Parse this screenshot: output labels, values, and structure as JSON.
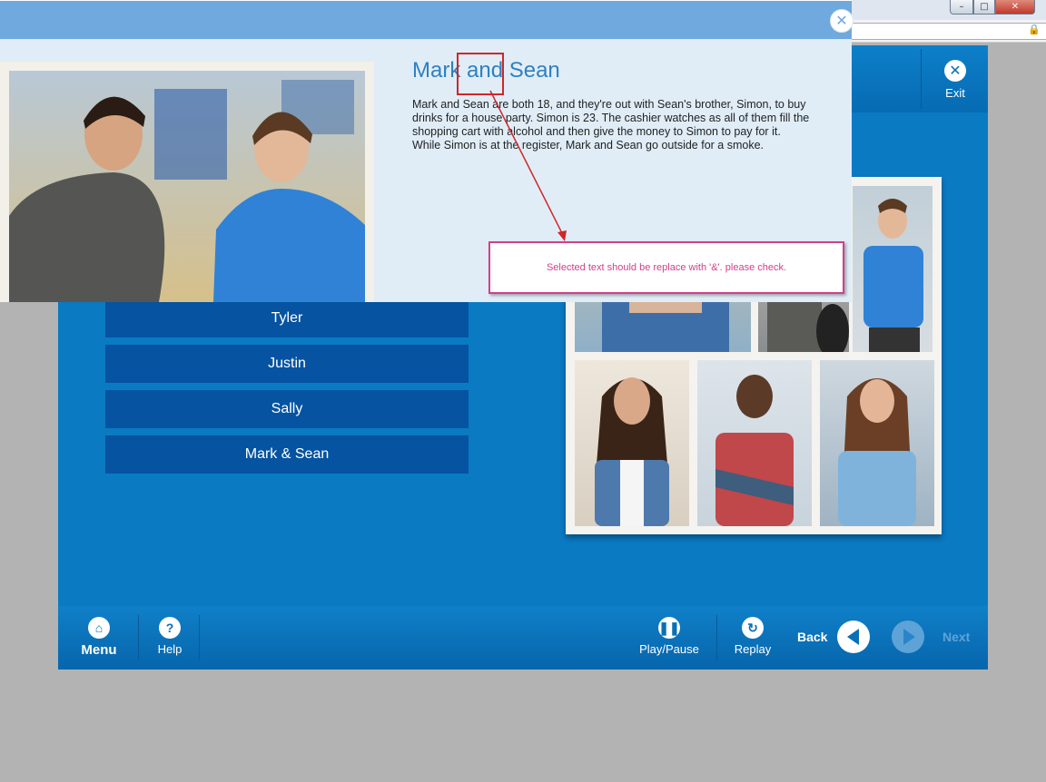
{
  "popup": {
    "title": "Mark and Sean",
    "body": "Mark and Sean are both 18, and they're out with Sean's brother, Simon, to buy drinks for a house party.  Simon is 23.  The cashier watches as all of them fill the shopping cart with alcohol and then give the money to Simon to pay for it.  While Simon is at the register, Mark and Sean go outside for a smoke.",
    "close_icon": "close-icon"
  },
  "annotation": {
    "comment": "Selected text should be replace with '&'. please check."
  },
  "header": {
    "exit_label": "Exit"
  },
  "choices": [
    {
      "label": "Tyler"
    },
    {
      "label": "Justin"
    },
    {
      "label": "Sally"
    },
    {
      "label": "Mark & Sean"
    }
  ],
  "footer": {
    "menu_label": "Menu",
    "help_label": "Help",
    "playpause_label": "Play/Pause",
    "replay_label": "Replay",
    "back_label": "Back",
    "next_label": "Next"
  },
  "colors": {
    "stage": "#0a7ac3",
    "choice_bg": "#0553a1",
    "popup_bg": "#e0edf7",
    "popup_title": "#2f80c0",
    "annotation_red": "#d0262a",
    "comment_pink": "#d23f8a"
  }
}
